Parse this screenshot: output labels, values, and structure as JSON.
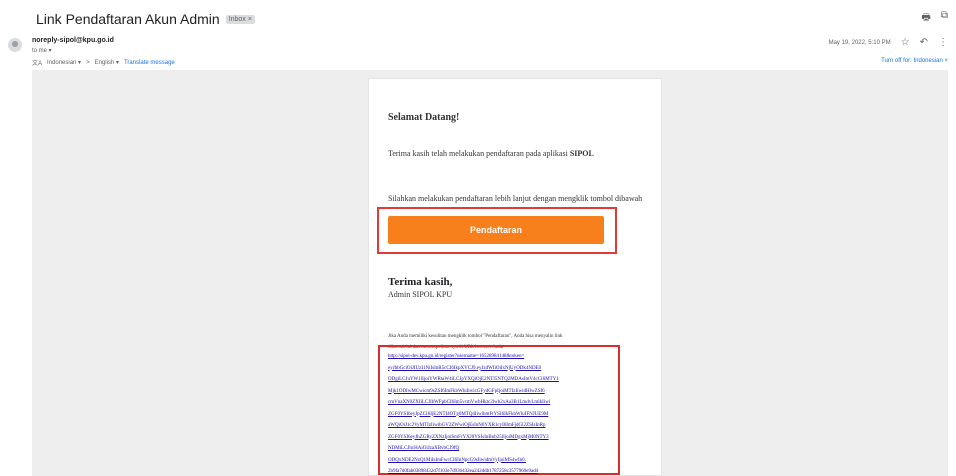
{
  "email": {
    "subject": "Link Pendaftaran Akun Admin",
    "label": "Inbox",
    "label_close": "×",
    "sender": "noreply-sipol@kpu.go.id",
    "to": "to me ▾",
    "date": "May 19, 2022, 5:10 PM"
  },
  "translate": {
    "source": "Indonesian ▾",
    "arrow": ">",
    "target": "English ▾",
    "action": "Translate message",
    "turn_off": "Turn off for: Indonesian ×"
  },
  "body": {
    "greeting": "Selamat Datang!",
    "thanks_prefix": "Terima kasih telah melakukan pendaftaran pada aplikasi ",
    "thanks_app": "SIPOL",
    "instruction": "Silahkan melakukan pendaftaran lebih lanjut dengan mengklik tombol dibawah",
    "button_label": "Pendaftaran",
    "closing_title": "Terima kasih,",
    "closing_sign": "Admin SIPOL KPU",
    "fallback_1": "Jika Anda memiliki kesulitan mengklik tombol \"Pendaftaran\", Anda bisa menyalin link",
    "fallback_2": "dibawah ini dan menempelkan nya di URL browser Anda",
    "url_lines": [
      "http://sipol-dev.kpu.go.id/register?username=16528984148&token=",
      "eyJhbGciOiJIUzI1NiIsInR5cCI6IkpXVCJ9.eyJzdWIiOiIxNjUyODk4NDE0",
      "ODgiLCJuYW1lIjoiYWRtaW4iLCJpYXQiOjE2NTI5NTQ2MDAsImV4cCI6MTY1",
      "Mjk1ODIwMCwicm9sZSI6ImFkbWluIiwicGFydGFpIjoiMTIzIiwidHlwZSI6",
      "cmVnaXN0ZXIiLCJlbWFpbCI6Im5vcmVwbHktc2lwb2xAa3B1LmdvLmlkIiwi",
      "ZGF0YSI6eyJpZCI6IjE2NTI4OTg0MTQ4IiwibmFtYSI6IkFkbWluIFNJUE9M",
      "aWQiOiJ1c2VyMTIzIiwibGV2ZWwiOjEsInN0YXR1cyI6ImFjdGl2ZSIsInRp",
      "ZGF0YSI6eyJhZGRyZXNzIjoiSmFrYXJ0YSIsInBob25lIjoiMDgxMjM0NTY3",
      "NDMiLCJhcHAiOiJzaXBvbCJ9fQ",
      "ODQxNDE2NzQ1MiIsImFwcCI6InNpcG9sIiwidmVyIjoiMS4wIn0.",
      "2b9fa7d0fab03898432d7f103e7d936432ea242ddb1787258c3577969e9ad4"
    ]
  }
}
